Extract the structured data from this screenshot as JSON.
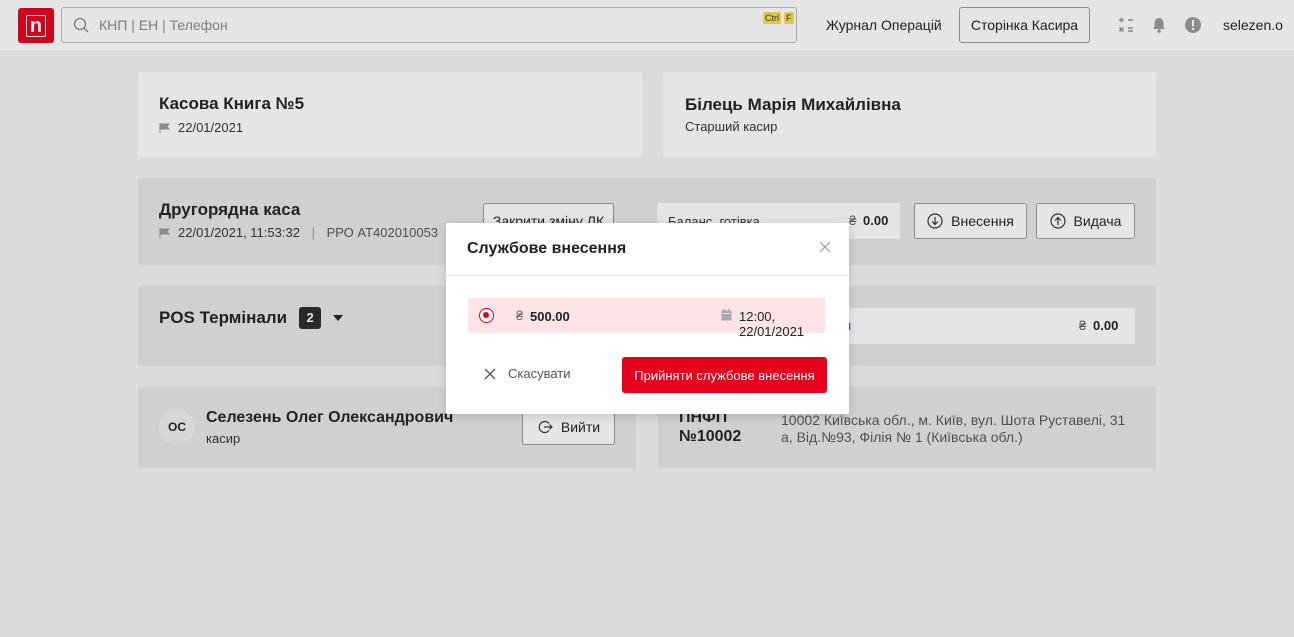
{
  "header": {
    "logo_label": "n",
    "search_placeholder": "КНП | ЕН | Телефон",
    "shortcut_ctrl": "Ctrl",
    "shortcut_key": "F",
    "journal_link": "Журнал Операцій",
    "cashier_page_button": "Сторінка Касира",
    "username": "selezen.o"
  },
  "cash_book": {
    "title": "Касова Книга №5",
    "date": "22/01/2021"
  },
  "cashier_profile": {
    "name": "Білець Марія Михайлівна",
    "role": "Старший касир"
  },
  "secondary_cash": {
    "title": "Другорядна каса",
    "datetime": "22/01/2021, 11:53:32",
    "separator": "|",
    "prro": "РРО AT402010053",
    "close_shift_button": "Закрити зміну ЛК",
    "balance_label": "Баланс, готівка",
    "balance_currency": "₴",
    "balance_value": "0.00",
    "deposit_button": "Внесення",
    "withdraw_button": "Видача"
  },
  "pos": {
    "title": "POS Термінали",
    "count": "2",
    "field_value_partial": "н",
    "currency": "₴",
    "value": "0.00"
  },
  "employee": {
    "initials": "ОС",
    "name": "Селезень Олег Олександрович",
    "role": "касир",
    "logout_button": "Вийти"
  },
  "branch": {
    "label_line1": "ПНФП",
    "label_line2": "№10002",
    "address": "10002 Київська обл., м. Київ, вул. Шота Руставелі, 31 а, Від.№93, Філія № 1 (Київська обл.)"
  },
  "modal": {
    "title": "Службове внесення",
    "entry_currency": "₴",
    "entry_amount": "500.00",
    "entry_datetime": "12:00, 22/01/2021",
    "cancel_label": "Скасувати",
    "accept_label": "Прийняти службове внесення"
  },
  "colors": {
    "brand_red": "#e5001c",
    "entry_highlight": "#fde4e8",
    "kbd_yellow": "#f7e04a"
  }
}
